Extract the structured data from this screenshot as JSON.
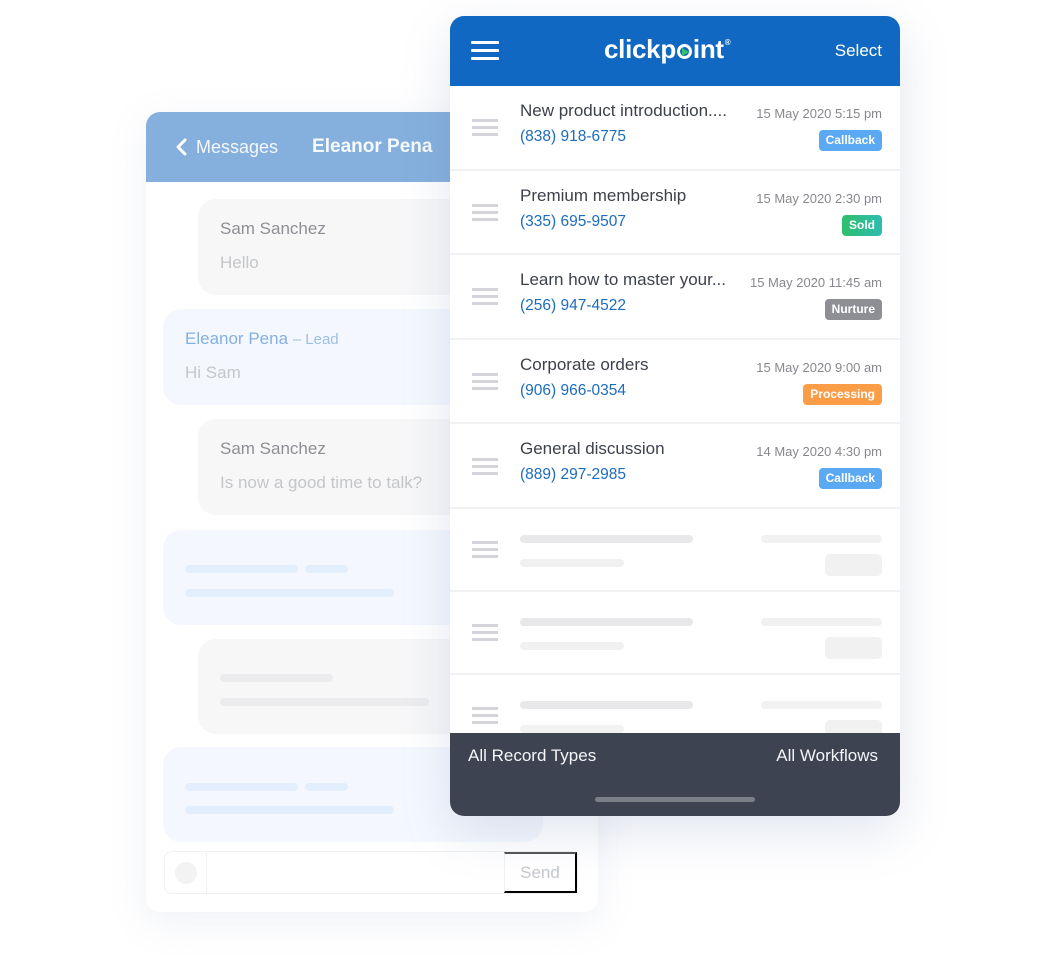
{
  "messages_panel": {
    "back_label": "Messages",
    "title": "Eleanor Pena",
    "conversation": [
      {
        "direction": "in",
        "sender": "Sam Sanchez",
        "text": "Hello"
      },
      {
        "direction": "out",
        "sender": "Eleanor Pena",
        "role": "– Lead",
        "text": "Hi Sam"
      },
      {
        "direction": "in",
        "sender": "Sam Sanchez",
        "text": "Is now a good time to talk?"
      }
    ],
    "composer": {
      "placeholder": "",
      "send_label": "Send"
    }
  },
  "app": {
    "brand": {
      "name_left": "clickp",
      "name_right": "int",
      "registered": "®",
      "accent_color": "#1168c2",
      "play_color": "#34c26b"
    },
    "select_label": "Select",
    "records": [
      {
        "title": "New product introduction....",
        "phone": "(838) 918-6775",
        "date": "15 May 2020 5:15 pm",
        "status": "Callback",
        "status_color": "#5aa9f2"
      },
      {
        "title": "Premium membership",
        "phone": "(335) 695-9507",
        "date": "15 May 2020 2:30 pm",
        "status": "Sold",
        "status_color": "#2fbf74"
      },
      {
        "title": "Learn how to master your...",
        "phone": "(256) 947-4522",
        "date": "15 May 2020 11:45 am",
        "status": "Nurture",
        "status_color": "#8d8f94"
      },
      {
        "title": "Corporate orders",
        "phone": "(906) 966-0354",
        "date": "15 May 2020 9:00 am",
        "status": "Processing",
        "status_color": "#fb9d47"
      },
      {
        "title": "General discussion",
        "phone": "(889) 297-2985",
        "date": "14 May 2020 4:30 pm",
        "status": "Callback",
        "status_color": "#5aa9f2"
      }
    ],
    "bottom_bar": {
      "left_label": "All Record Types",
      "right_label": "All Workflows"
    }
  }
}
